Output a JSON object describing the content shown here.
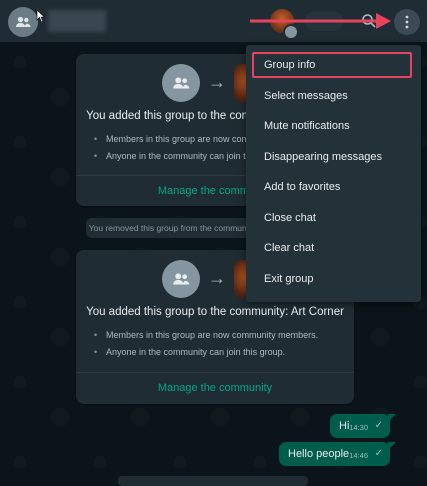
{
  "header": {
    "contact_name": "",
    "avatar_icon": "group-avatar-icon",
    "search_icon": "search-icon",
    "menu_icon": "kebab-menu-icon"
  },
  "cards": [
    {
      "title": "You added this group to the community: Art Corner",
      "bullets": [
        "Members in this group are now community members.",
        "Anyone in the community can join this group."
      ],
      "link": "Manage the community"
    },
    {
      "title": "You added this group to the community: Art Corner",
      "bullets": [
        "Members in this group are now community members.",
        "Anyone in the community can join this group."
      ],
      "link": "Manage the community"
    }
  ],
  "system_message": "You removed this group from the community",
  "messages": [
    {
      "text": "Hi",
      "time": "14:30",
      "status": "✓"
    },
    {
      "text": "Hello people",
      "time": "14:46",
      "status": "✓"
    }
  ],
  "dropdown": {
    "items": [
      "Group info",
      "Select messages",
      "Mute notifications",
      "Disappearing messages",
      "Add to favorites",
      "Close chat",
      "Clear chat",
      "Exit group"
    ],
    "highlighted_index": 0
  },
  "colors": {
    "accent": "#00a884",
    "annotation": "#e8435e",
    "outgoing_bubble": "#005c4b",
    "panel": "#202c33"
  }
}
